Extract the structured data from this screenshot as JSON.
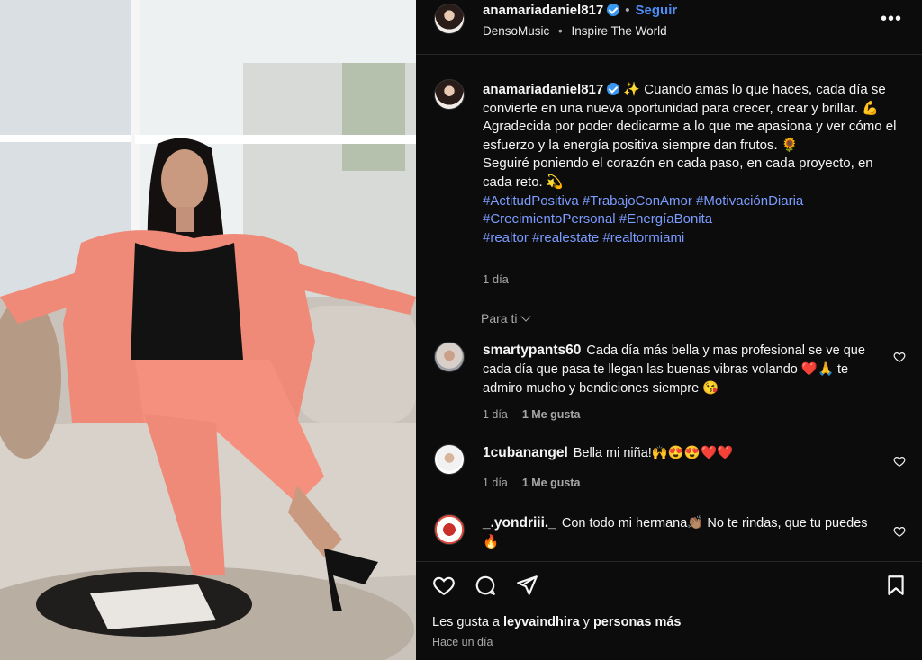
{
  "header": {
    "username": "anamariadaniel817",
    "separator": "•",
    "follow_label": "Seguir",
    "subtitle_left": "DensoMusic",
    "subtitle_sep": "•",
    "subtitle_right": "Inspire The World",
    "more_label": "•••"
  },
  "caption": {
    "username": "anamariadaniel817",
    "line1": "✨ Cuando amas lo que haces, cada día se convierte en una nueva oportunidad para crecer, crear y brillar. 💪",
    "line2": "Agradecida por poder dedicarme a lo que me apasiona y ver cómo el esfuerzo y la energía positiva siempre dan frutos. 🌻",
    "line3": "Seguiré poniendo el corazón en cada paso, en cada proyecto, en cada reto. 💫",
    "tags1": "#ActitudPositiva #TrabajoConAmor #MotivaciónDiaria",
    "tags2": "#CrecimientoPersonal #EnergíaBonita",
    "tags3": "#realtor #realestate #realtormiami",
    "time": "1 día"
  },
  "para_ti": "Para ti",
  "comments": [
    {
      "username": "smartypants60",
      "text": "Cada día más bella y mas profesional se ve que cada día que pasa te llegan las buenas vibras volando ❤️🙏 te admiro mucho y bendiciones siempre 😘",
      "time": "1 día",
      "likes": "1 Me gusta"
    },
    {
      "username": "1cubanangel",
      "text": "Bella mi niña!🙌😍😍❤️❤️",
      "time": "1 día",
      "likes": "1 Me gusta"
    },
    {
      "username": "_.yondriii._",
      "text": "Con todo mi hermana👏🏽 No te rindas, que tu puedes🔥"
    }
  ],
  "likes": {
    "prefix": "Les gusta a",
    "user": "leyvaindhira",
    "joiner": "y",
    "others": "personas más"
  },
  "posted": "Hace un día",
  "colors": {
    "link": "#4f8ef7",
    "hashtag": "#7b9bff",
    "suit": "#f08a78",
    "background": "#0c0c0c"
  },
  "icons": [
    "like-icon",
    "comment-icon",
    "share-icon",
    "save-icon",
    "more-icon",
    "verified-icon",
    "heart-icon",
    "chevron-down-icon"
  ]
}
